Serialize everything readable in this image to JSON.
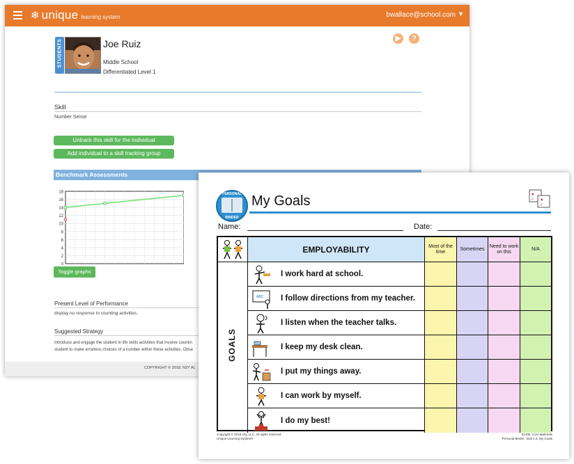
{
  "app": {
    "logo_text": "unique",
    "logo_subtext": "learning system",
    "user_email": "bwallace@school.com",
    "students_tab_label": "STUDENTS"
  },
  "student": {
    "name": "Joe Ruiz",
    "school": "Middle School",
    "level": "Differentiated Level 1"
  },
  "skill": {
    "heading": "Skill",
    "value": "Number Sense",
    "untrack_label": "Untrack this skill for the individual",
    "add_group_label": "Add individual to a skill tracking group"
  },
  "benchmark": {
    "heading": "Benchmark Assessments",
    "toggle_label": "Toggle graphs"
  },
  "chart_data": {
    "type": "line",
    "ylim": [
      0,
      18
    ],
    "yticks": [
      "0",
      "2",
      "4",
      "6",
      "8",
      "10",
      "12",
      "14",
      "16",
      "18"
    ],
    "series": [
      {
        "points": [
          [
            0,
            14
          ],
          [
            4,
            15
          ],
          [
            12,
            17
          ]
        ]
      }
    ],
    "marker": [
      0,
      11
    ],
    "grid": true
  },
  "performance": {
    "heading": "Present Level of Performance",
    "value": "display no response to counting activities."
  },
  "strategy": {
    "heading": "Suggested Strategy",
    "line1": "Introduce and engage the student in life skills activities that involve countin",
    "line2": "student to make errorless choices of a number within these activities. Obse"
  },
  "footer": {
    "copyright": "COPYRIGHT © 2018, N2Y AL"
  },
  "worksheet": {
    "badge_top": "PERSONAL",
    "badge_bottom": "BINDER",
    "title": "My Goals",
    "name_label": "Name:",
    "date_label": "Date:",
    "table_title": "EMPLOYABILITY",
    "columns": [
      "Most of the time",
      "Sometimes",
      "Need to work on this",
      "N/A"
    ],
    "side_label": "GOALS",
    "goals": [
      "I work hard at school.",
      "I follow directions from my teacher.",
      "I listen when the teacher talks.",
      "I keep my desk clean.",
      "I put my things away.",
      "I can work by myself.",
      "I do my best!"
    ],
    "footer_left_1": "Copyright © 2018 n2y, LLC. All rights reserved.",
    "footer_left_2": "Unique Learning System®",
    "footer_right_1": "ELEM, Core Materials",
    "footer_right_2": "Personal Binder, Task 1.4, My Goals"
  }
}
